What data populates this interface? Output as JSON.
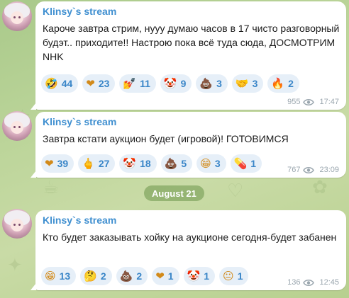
{
  "colors": {
    "sender": "#3f8fd0",
    "reaction_bg": "#e6eff8",
    "reaction_count": "#3a86c8",
    "meta": "#9aa6ae",
    "date_pill_bg": "#6c964a"
  },
  "date_separator": "August 21",
  "messages": [
    {
      "sender": "Klinsy`s stream",
      "text": "Кароче завтра стрим, нууу думаю часов в 17 чисто разговорный будэт.. приходите!! Настрою пока всё туда сюда, ДОСМОТРИМ NHK",
      "views": "955",
      "time": "17:47",
      "reactions": [
        {
          "emoji": "🤣",
          "icon": "rolling-laughing-icon",
          "count": "44"
        },
        {
          "emoji": "❤",
          "icon": "heart-icon",
          "count": "23"
        },
        {
          "emoji": "💅",
          "icon": "nail-polish-icon",
          "count": "11"
        },
        {
          "emoji": "🤡",
          "icon": "clown-icon",
          "count": "9"
        },
        {
          "emoji": "💩",
          "icon": "poop-icon",
          "count": "3"
        },
        {
          "emoji": "🤝",
          "icon": "handshake-icon",
          "count": "3"
        },
        {
          "emoji": "🔥",
          "icon": "fire-icon",
          "count": "2"
        }
      ]
    },
    {
      "sender": "Klinsy`s stream",
      "text": "Завтра кстати аукцион будет (игровой)! ГОТОВИМСЯ",
      "views": "767",
      "time": "23:09",
      "reactions": [
        {
          "emoji": "❤",
          "icon": "heart-icon",
          "count": "39"
        },
        {
          "emoji": "🖕",
          "icon": "middle-finger-icon",
          "count": "27"
        },
        {
          "emoji": "🤡",
          "icon": "clown-icon",
          "count": "18"
        },
        {
          "emoji": "💩",
          "icon": "poop-icon",
          "count": "5"
        },
        {
          "emoji": "😁",
          "icon": "grin-icon",
          "count": "3"
        },
        {
          "emoji": "💊",
          "icon": "pill-icon",
          "count": "1"
        }
      ]
    },
    {
      "sender": "Klinsy`s stream",
      "text": "Кто будет заказывать хойку на аукционе сегодня-будет забанен",
      "views": "136",
      "time": "12:45",
      "reactions": [
        {
          "emoji": "😁",
          "icon": "grin-icon",
          "count": "13"
        },
        {
          "emoji": "🤔",
          "icon": "thinking-icon",
          "count": "2"
        },
        {
          "emoji": "💩",
          "icon": "poop-icon",
          "count": "2"
        },
        {
          "emoji": "❤",
          "icon": "heart-icon",
          "count": "1"
        },
        {
          "emoji": "🤡",
          "icon": "clown-icon",
          "count": "1"
        },
        {
          "emoji": "😐",
          "icon": "neutral-face-icon",
          "count": "1"
        }
      ]
    }
  ]
}
